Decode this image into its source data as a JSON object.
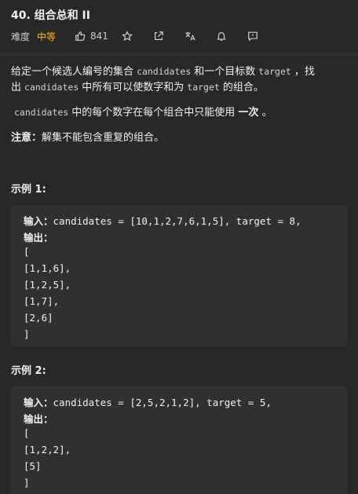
{
  "problem": {
    "title": "40. 组合总和 II",
    "difficulty_label": "难度",
    "difficulty": "中等",
    "likes": "841"
  },
  "description": {
    "p1_a": "给定一个候选人编号的集合",
    "p1_code1": "candidates",
    "p1_b": "和一个目标数",
    "p1_code2": "target",
    "p1_c": "，找",
    "p1_d": "出",
    "p1_code3": "candidates",
    "p1_e": "中所有可以使数字和为",
    "p1_code4": "target",
    "p1_f": "的组合。",
    "p2_code": "candidates",
    "p2_a": "中的每个数字在每个组合中只能使用",
    "p2_bold": "一次",
    "p2_b": "。",
    "note_label": "注意：",
    "note_text": "解集不能包含重复的组合。"
  },
  "examples": [
    {
      "heading": "示例 1:",
      "input_label": "输入：",
      "input": "candidates = [10,1,2,7,6,1,5], target = 8,",
      "output_label": "输出：",
      "output_lines": [
        "[",
        "[1,1,6],",
        "[1,2,5],",
        "[1,7],",
        "[2,6]",
        "]"
      ]
    },
    {
      "heading": "示例 2:",
      "input_label": "输入：",
      "input": "candidates = [2,5,2,1,2], target = 5,",
      "output_label": "输出：",
      "output_lines": [
        "[",
        "[1,2,2],",
        "[5]",
        "]"
      ]
    }
  ],
  "colors": {
    "background": "#282828",
    "code_block": "#303030",
    "difficulty": "#ffb800"
  },
  "icons": [
    "thumbs-up-icon",
    "star-icon",
    "share-icon",
    "translate-icon",
    "bell-icon",
    "feedback-icon"
  ]
}
